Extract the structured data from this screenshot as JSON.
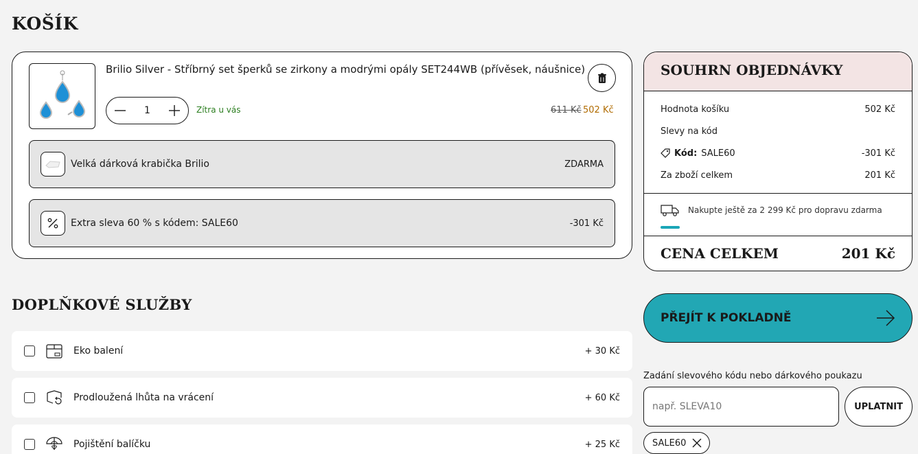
{
  "page": {
    "title": "KOŠÍK"
  },
  "cart": {
    "item": {
      "name": "Brilio Silver - Stříbrný set šperků se zirkony a modrými opály SET244WB (přívěsek, náušnice)",
      "quantity": "1",
      "delivery": "Zítra u vás",
      "old_price": "611 Kč",
      "price": "502 Kč"
    },
    "extras": [
      {
        "label": "Velká dárková krabička Brilio",
        "value": "ZDARMA",
        "icon": "gift-box-icon"
      },
      {
        "label": "Extra sleva 60 % s kódem: SALE60",
        "value": "-301 Kč",
        "icon": "percent-icon"
      }
    ]
  },
  "summary": {
    "title": "SOUHRN OBJEDNÁVKY",
    "lines": [
      {
        "label": "Hodnota košíku",
        "value": "502 Kč"
      },
      {
        "label": "Slevy na kód",
        "value": ""
      },
      {
        "label_bold": "Kód:",
        "label": "SALE60",
        "value": "-301 Kč"
      },
      {
        "label": "Za zboží celkem",
        "value": "201 Kč"
      }
    ],
    "shipping_text": "Nakupte ještě za 2 299 Kč pro dopravu zdarma",
    "total_label": "CENA CELKEM",
    "total_value": "201 Kč"
  },
  "checkout": {
    "label": "PŘEJÍT K POKLADNĚ"
  },
  "coupon": {
    "label": "Zadání slevového kódu nebo dárkového poukazu",
    "placeholder": "např. SLEVA10",
    "apply_label": "UPLATNIT",
    "applied_code": "SALE60"
  },
  "services": {
    "title": "DOPLŇKOVÉ SLUŽBY",
    "items": [
      {
        "label": "Eko balení",
        "value": "+ 30 Kč"
      },
      {
        "label": "Prodloužená lhůta na vrácení",
        "value": "+ 60 Kč"
      },
      {
        "label": "Pojištění balíčku",
        "value": "+ 25 Kč"
      }
    ]
  },
  "colors": {
    "accent": "#22a7b4",
    "summary_header": "#f3e4e4",
    "price": "#b06b00",
    "delivery": "#2a7d1e"
  }
}
